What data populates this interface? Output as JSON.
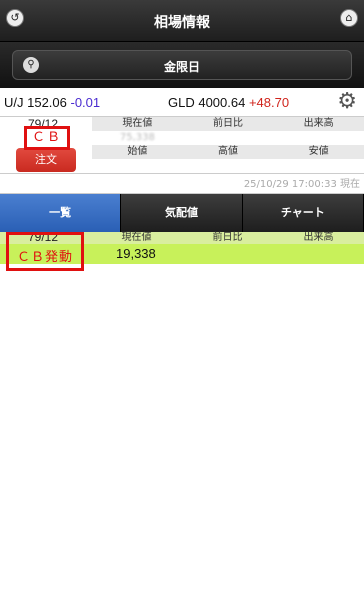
{
  "header": {
    "title": "相場情報",
    "back_icon": "back-icon",
    "home_icon": "home-icon"
  },
  "daybar": {
    "label": "金限日"
  },
  "ticker": {
    "uj_label": "U/J 152.06",
    "uj_change": "-0.01",
    "gld_label": "GLD 4000.64",
    "gld_change": "+48.70"
  },
  "quote": {
    "code": "79/12",
    "cb_label": "ＣＢ",
    "order_label": "注文",
    "headers_row1": [
      "現在値",
      "前日比",
      "出来高"
    ],
    "values_row1": [
      "75,338",
      "",
      ""
    ],
    "headers_row2": [
      "始値",
      "高値",
      "安値"
    ]
  },
  "timestamp": "25/10/29 17:00:33 現在",
  "tabs": [
    "一覧",
    "気配値",
    "チャート"
  ],
  "list": {
    "code": "79/12",
    "headers": [
      "現在値",
      "前日比",
      "出来高"
    ],
    "cb_label": "ＣＢ発動",
    "price": "19,338"
  },
  "colors": {
    "accent_blue": "#2a5fb5",
    "cb_red": "#e01010",
    "list_green": "#c8f15a",
    "order_red": "#d0241c"
  }
}
